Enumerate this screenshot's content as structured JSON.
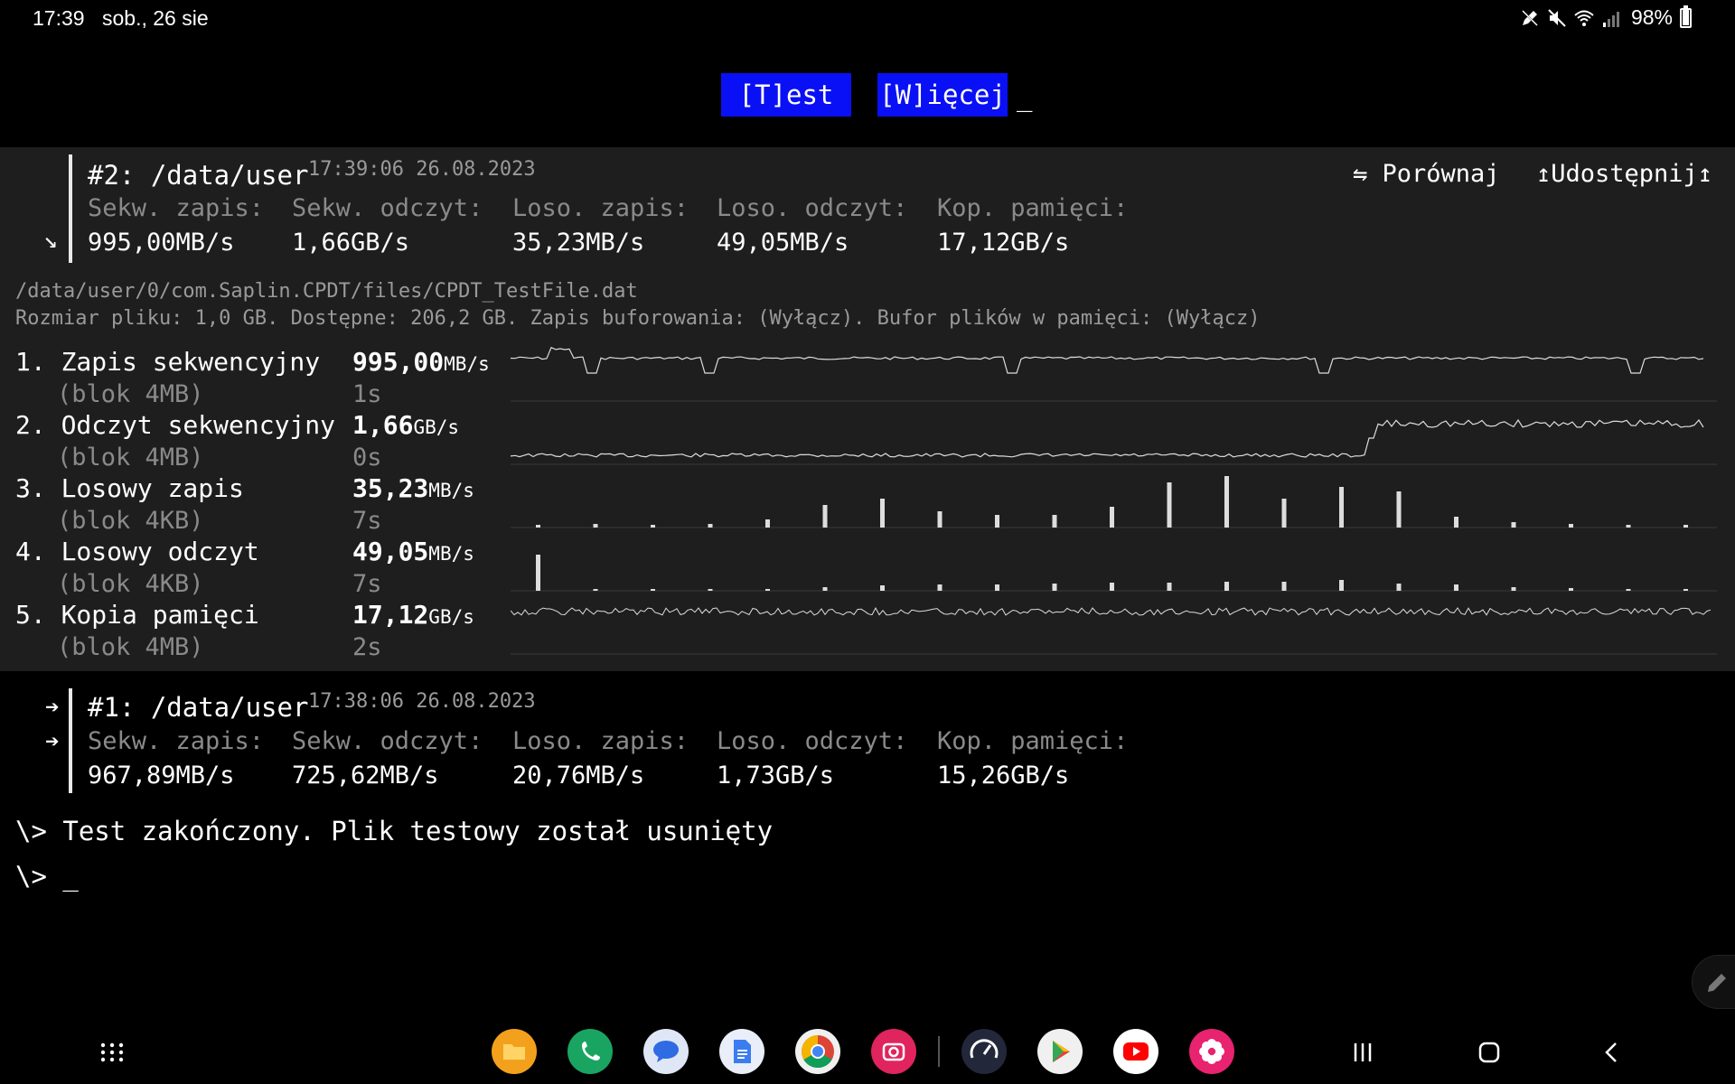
{
  "status_bar": {
    "time": "17:39",
    "date": "sob., 26 sie",
    "battery": "98%",
    "battery_level": 0.98,
    "icons": [
      "pen-off-icon",
      "mute-icon",
      "wifi-icon",
      "signal-icon",
      "battery-icon"
    ]
  },
  "toolbar": {
    "test_label": "[T]est",
    "more_label": "[W]ięcej",
    "cursor": "_"
  },
  "current_result": {
    "title": "#2: /data/user",
    "timestamp": "17:39:06 26.08.2023",
    "compare_label": "⇋ Porównaj",
    "share_label": "↥Udostępnij↥",
    "metrics": [
      {
        "label": "Sekw. zapis:",
        "value": "995,00MB/s"
      },
      {
        "label": "Sekw. odczyt:",
        "value": "1,66GB/s"
      },
      {
        "label": "Loso. zapis:",
        "value": "35,23MB/s"
      },
      {
        "label": "Loso. odczyt:",
        "value": "49,05MB/s"
      },
      {
        "label": "Kop. pamięci:",
        "value": "17,12GB/s"
      }
    ],
    "file_path": "/data/user/0/com.Saplin.CPDT/files/CPDT_TestFile.dat",
    "file_info": "Rozmiar pliku: 1,0 GB. Dostępne: 206,2 GB. Zapis buforowania: (Wyłącz). Bufor plików w pamięci: (Wyłącz)",
    "tests": [
      {
        "name": "1. Zapis sekwencyjny",
        "block": "(blok 4MB)",
        "speed": "995,00",
        "unit": "MB/s",
        "duration": "1s"
      },
      {
        "name": "2. Odczyt sekwencyjny",
        "block": "(blok 4MB)",
        "speed": "1,66",
        "unit": "GB/s",
        "duration": "0s"
      },
      {
        "name": "3. Losowy zapis",
        "block": "(blok 4KB)",
        "speed": "35,23",
        "unit": "MB/s",
        "duration": "7s"
      },
      {
        "name": "4. Losowy odczyt",
        "block": "(blok 4KB)",
        "speed": "49,05",
        "unit": "MB/s",
        "duration": "7s"
      },
      {
        "name": "5. Kopia pamięci",
        "block": "(blok 4MB)",
        "speed": "17,12",
        "unit": "GB/s",
        "duration": "2s"
      }
    ]
  },
  "previous_result": {
    "title": "#1: /data/user",
    "timestamp": "17:38:06 26.08.2023",
    "metrics": [
      {
        "label": "Sekw. zapis:",
        "value": "967,89MB/s"
      },
      {
        "label": "Sekw. odczyt:",
        "value": "725,62MB/s"
      },
      {
        "label": "Loso. zapis:",
        "value": "20,76MB/s"
      },
      {
        "label": "Loso. odczyt:",
        "value": "1,73GB/s"
      },
      {
        "label": "Kop. pamięci:",
        "value": "15,26GB/s"
      }
    ]
  },
  "terminal": {
    "line1": "\\> Test zakończony. Plik testowy został usunięty",
    "line2": "\\> _"
  },
  "dock": {
    "apps": [
      "files-app-icon",
      "phone-app-icon",
      "messages-app-icon",
      "docs-app-icon",
      "chrome-app-icon",
      "camera-app-icon",
      "speedometer-app-icon",
      "play-store-app-icon",
      "youtube-app-icon",
      "flower-app-icon"
    ]
  },
  "colors": {
    "button_bg": "#0a10f5",
    "panel_bg": "#1e1e1e",
    "label_gray": "#8a8a8a"
  }
}
